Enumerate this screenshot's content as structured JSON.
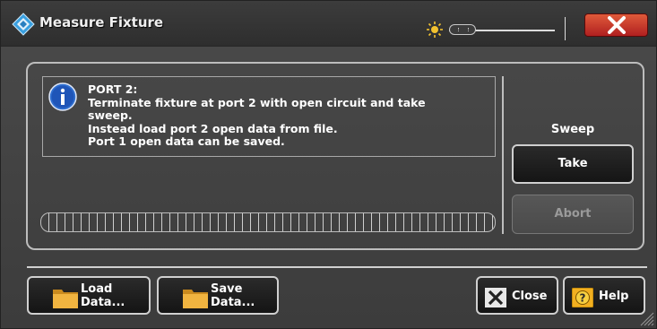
{
  "window": {
    "title": "Measure Fixture",
    "icons": {
      "app": "diamond-logo-icon",
      "brightness": "sun-icon",
      "close": "close-x-icon"
    },
    "colors": {
      "background": "#3c3c3c",
      "close_button": "#c8321e",
      "accent_text": "#ffffff"
    }
  },
  "message": {
    "icon": "info-icon",
    "text": "PORT 2:\nTerminate fixture at port 2 with open circuit and take\nsweep.\nInstead load port 2 open data from file.\nPort 1 open data can be saved."
  },
  "progress": {
    "value": 0
  },
  "sweep": {
    "label": "Sweep",
    "take_label": "Take",
    "abort_label": "Abort"
  },
  "footer": {
    "load_label": "Load\nData...",
    "save_label": "Save\nData...",
    "close_label": "Close",
    "help_label": "Help"
  }
}
